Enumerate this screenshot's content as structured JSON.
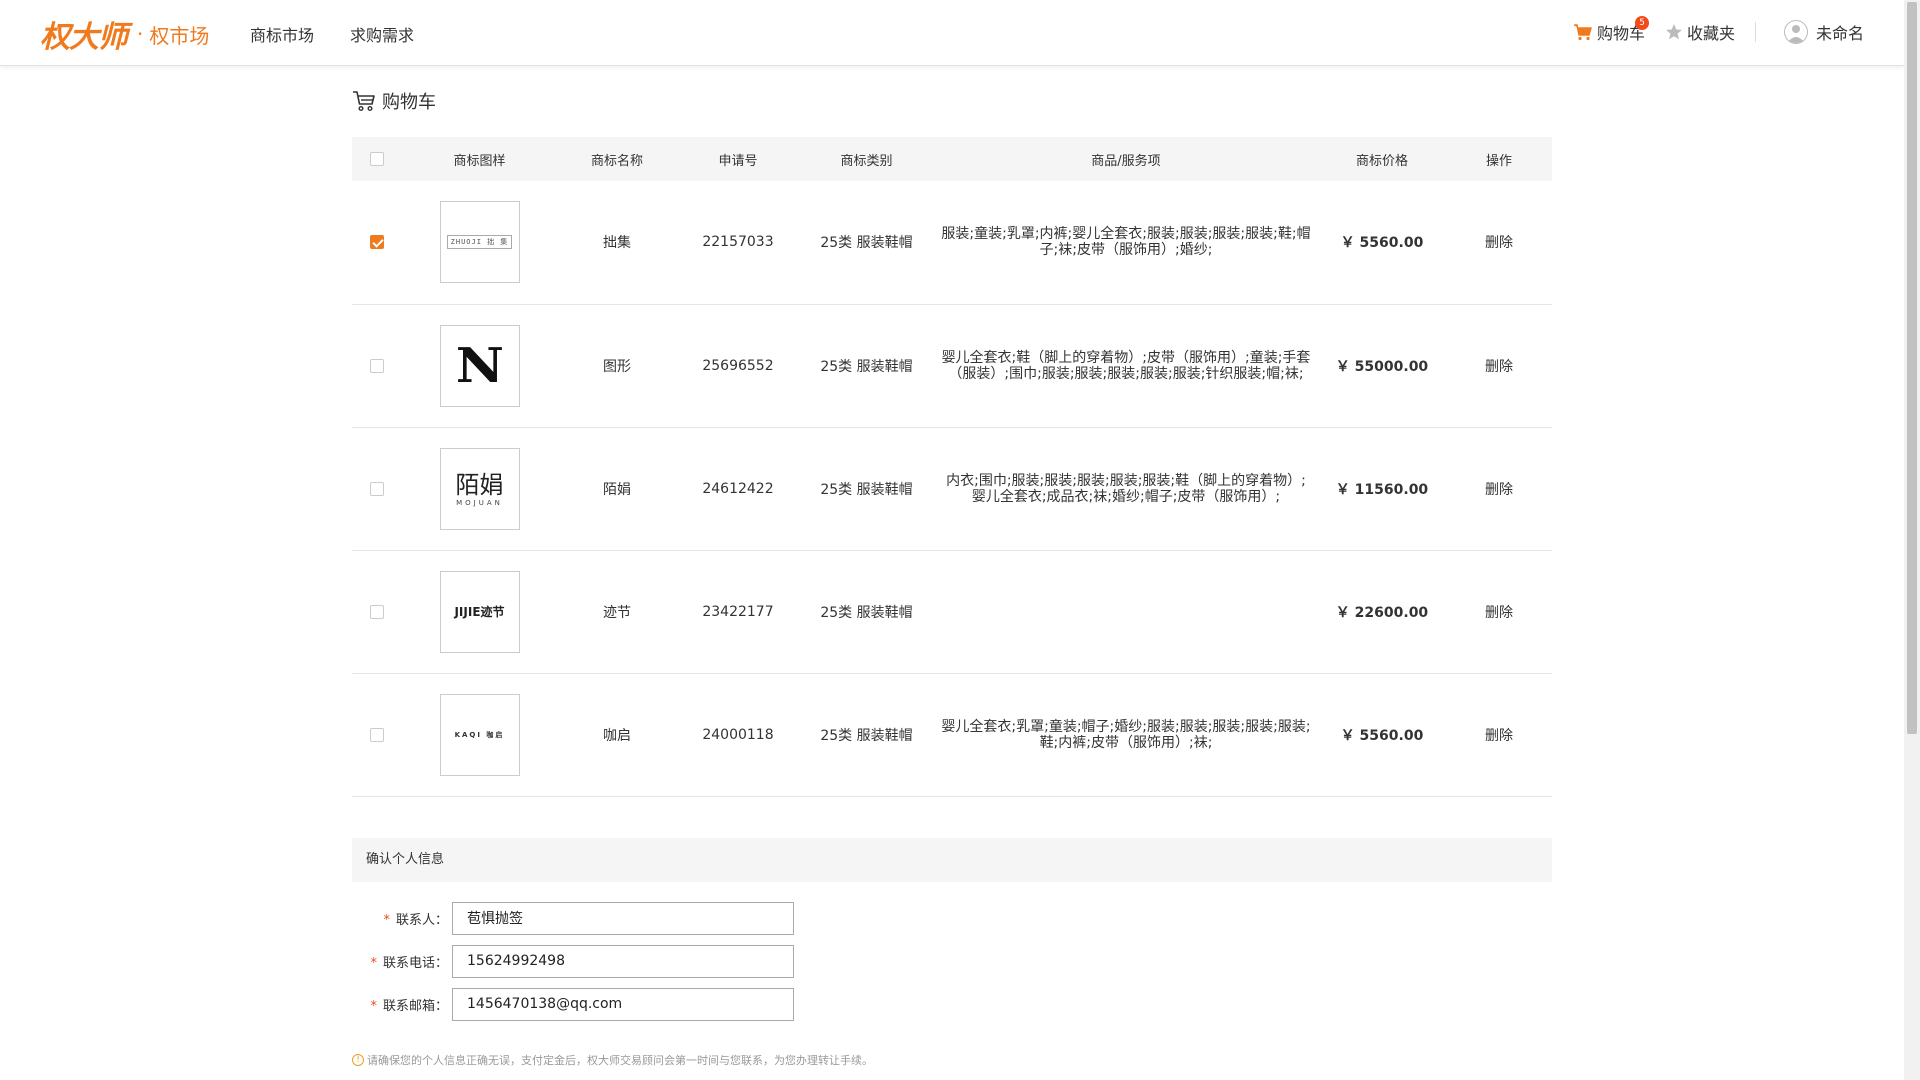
{
  "header": {
    "logo_brand": "权大师",
    "logo_dot": "·",
    "logo_sub": "权市场",
    "nav": [
      "商标市场",
      "求购需求"
    ],
    "cart_label": "购物车",
    "cart_count": "5",
    "favorites_label": "收藏夹",
    "user_name": "未命名"
  },
  "page_title": "购物车",
  "table": {
    "columns": [
      "商标图样",
      "商标名称",
      "申请号",
      "商标类别",
      "商品/服务项",
      "商标价格",
      "操作"
    ],
    "rows": [
      {
        "checked": true,
        "logo_text": "ZHUOJI 拙 集",
        "name": "拙集",
        "app_no": "22157033",
        "category": "25类 服装鞋帽",
        "services": "服装;童装;乳罩;内裤;婴儿全套衣;服装;服装;服装;服装;鞋;帽子;袜;皮带（服饰用）;婚纱;",
        "price": "￥ 5560.00",
        "action": "删除"
      },
      {
        "checked": false,
        "logo_text": "N",
        "name": "图形",
        "app_no": "25696552",
        "category": "25类 服装鞋帽",
        "services": "婴儿全套衣;鞋（脚上的穿着物）;皮带（服饰用）;童装;手套（服装）;围巾;服装;服装;服装;服装;服装;针织服装;帽;袜;",
        "price": "￥ 55000.00",
        "action": "删除"
      },
      {
        "checked": false,
        "logo_text": "陌娟",
        "logo_sub": "MOJUAN",
        "name": "陌娟",
        "app_no": "24612422",
        "category": "25类 服装鞋帽",
        "services": "内衣;围巾;服装;服装;服装;服装;服装;鞋（脚上的穿着物）;婴儿全套衣;成品衣;袜;婚纱;帽子;皮带（服饰用）;",
        "price": "￥ 11560.00",
        "action": "删除"
      },
      {
        "checked": false,
        "logo_text": "JIJIE迹节",
        "name": "迹节",
        "app_no": "23422177",
        "category": "25类 服装鞋帽",
        "services": "",
        "price": "￥ 22600.00",
        "action": "删除"
      },
      {
        "checked": false,
        "logo_text": "KAQI 咖启",
        "name": "咖启",
        "app_no": "24000118",
        "category": "25类 服装鞋帽",
        "services": "婴儿全套衣;乳罩;童装;帽子;婚纱;服装;服装;服装;服装;服装;鞋;内裤;皮带（服饰用）;袜;",
        "price": "￥ 5560.00",
        "action": "删除"
      }
    ]
  },
  "personal_info": {
    "title": "确认个人信息",
    "fields": [
      {
        "label": "联系人：",
        "value": "苞惧抛签"
      },
      {
        "label": "联系电话：",
        "value": "15624992498"
      },
      {
        "label": "联系邮箱：",
        "value": "1456470138@qq.com"
      }
    ],
    "notice": "请确保您的个人信息正确无误，支付定金后，权大师交易顾问会第一时间与您联系，为您办理转让手续。"
  },
  "colors": {
    "accent": "#f07a1e",
    "price": "#f04a1c",
    "header_bg": "#f5f5f5"
  }
}
